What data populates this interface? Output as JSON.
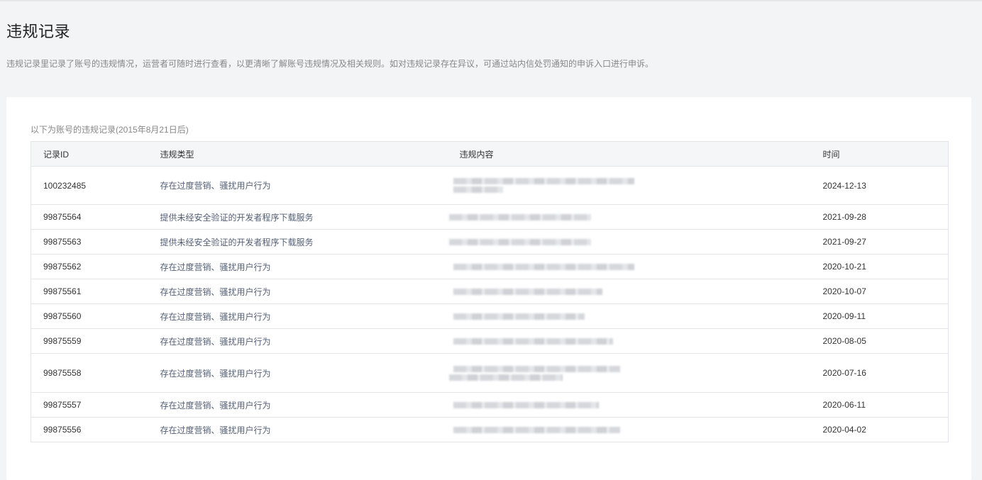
{
  "page": {
    "title": "违规记录",
    "description": "违规记录里记录了账号的违规情况，运营者可随时进行查看，以更清晰了解账号违规情况及相关规则。如对违规记录存在异议，可通过站内信处罚通知的申诉入口进行申诉。"
  },
  "panel": {
    "caption": "以下为账号的违规记录(2015年8月21日后)"
  },
  "table": {
    "columns": [
      "记录ID",
      "违规类型",
      "违规内容",
      "时间"
    ],
    "rows": [
      {
        "id": "100232485",
        "type": "存在过度营销、骚扰用户行为",
        "time": "2024-12-13"
      },
      {
        "id": "99875564",
        "type": "提供未经安全验证的开发者程序下载服务",
        "time": "2021-09-28"
      },
      {
        "id": "99875563",
        "type": "提供未经安全验证的开发者程序下载服务",
        "time": "2021-09-27"
      },
      {
        "id": "99875562",
        "type": "存在过度营销、骚扰用户行为",
        "time": "2020-10-21"
      },
      {
        "id": "99875561",
        "type": "存在过度营销、骚扰用户行为",
        "time": "2020-10-07"
      },
      {
        "id": "99875560",
        "type": "存在过度营销、骚扰用户行为",
        "time": "2020-09-11"
      },
      {
        "id": "99875559",
        "type": "存在过度营销、骚扰用户行为",
        "time": "2020-08-05"
      },
      {
        "id": "99875558",
        "type": "存在过度营销、骚扰用户行为",
        "time": "2020-07-16"
      },
      {
        "id": "99875557",
        "type": "存在过度营销、骚扰用户行为",
        "time": "2020-06-11"
      },
      {
        "id": "99875556",
        "type": "存在过度营销、骚扰用户行为",
        "time": "2020-04-02"
      }
    ]
  }
}
